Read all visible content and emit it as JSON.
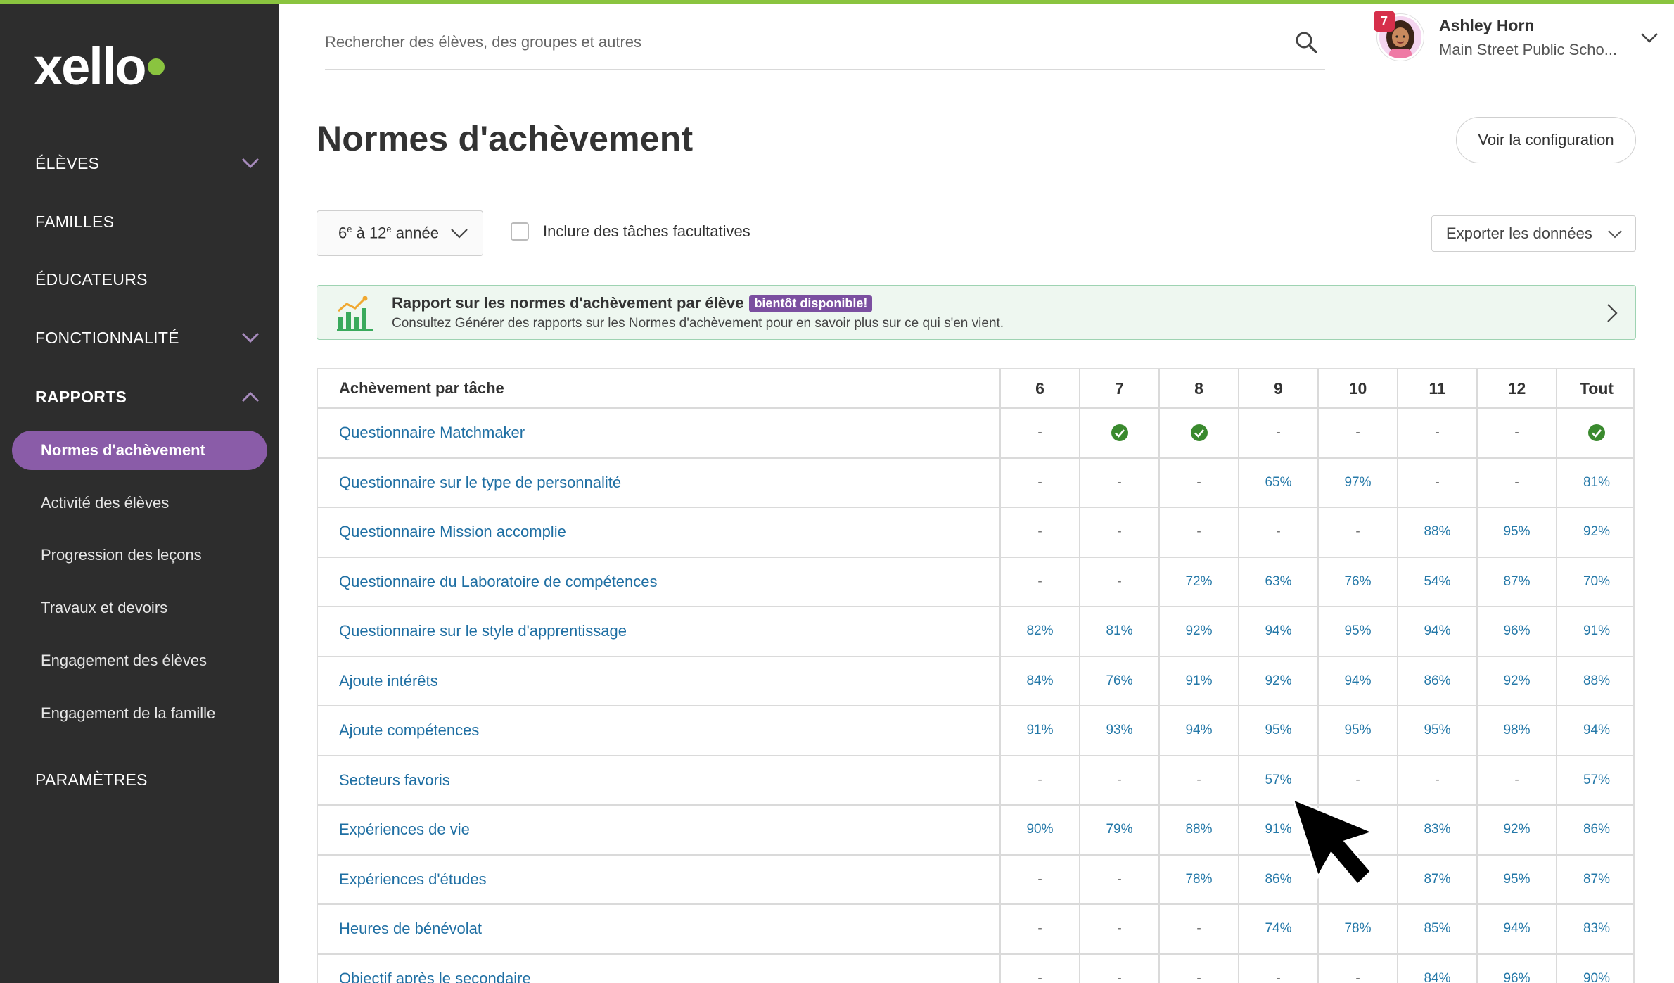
{
  "app": {
    "logo_text": "xello",
    "accent_color": "#8ac43f",
    "sidebar_bg": "#2d2d2d",
    "active_color": "#8a5ca8"
  },
  "sidebar": {
    "items": [
      {
        "label": "ÉLÈVES",
        "has_chevron": true,
        "expanded": false
      },
      {
        "label": "FAMILLES",
        "has_chevron": false
      },
      {
        "label": "ÉDUCATEURS",
        "has_chevron": false
      },
      {
        "label": "FONCTIONNALITÉ",
        "has_chevron": true,
        "expanded": false
      },
      {
        "label": "RAPPORTS",
        "has_chevron": true,
        "expanded": true
      },
      {
        "label": "PARAMÈTRES",
        "has_chevron": false
      }
    ],
    "reports_sub": [
      {
        "label": "Normes d'achèvement",
        "active": true
      },
      {
        "label": "Activité des élèves"
      },
      {
        "label": "Progression des leçons"
      },
      {
        "label": "Travaux et devoirs"
      },
      {
        "label": "Engagement des élèves"
      },
      {
        "label": "Engagement de la famille"
      }
    ]
  },
  "header": {
    "search_placeholder": "Rechercher des élèves, des groupes et autres",
    "search_icon": "search-icon",
    "user": {
      "name": "Ashley Horn",
      "school": "Main Street Public Scho...",
      "notifications": "7"
    }
  },
  "page": {
    "title": "Normes d'achèvement",
    "config_button": "Voir la configuration",
    "grade_select": {
      "prefix": "6",
      "sup1": "e",
      "mid": " à 12",
      "sup2": "e",
      "suffix": " année"
    },
    "optional_checkbox": {
      "label": "Inclure des tâches facultatives",
      "checked": false
    },
    "export_button": "Exporter les données"
  },
  "banner": {
    "title": "Rapport sur les normes d'achèvement par élève",
    "badge": "bientôt disponible!",
    "subtitle": "Consultez Générer des rapports sur les Normes d'achèvement pour en savoir plus sur ce qui s'en vient."
  },
  "table": {
    "task_header": "Achèvement par tâche",
    "columns": [
      "6",
      "7",
      "8",
      "9",
      "10",
      "11",
      "12",
      "Tout"
    ],
    "rows": [
      {
        "task": "Questionnaire Matchmaker",
        "values": [
          "-",
          "check",
          "check",
          "-",
          "-",
          "-",
          "-",
          "check"
        ]
      },
      {
        "task": "Questionnaire sur le type de personnalité",
        "values": [
          "-",
          "-",
          "-",
          "65%",
          "97%",
          "-",
          "-",
          "81%"
        ]
      },
      {
        "task": "Questionnaire Mission accomplie",
        "values": [
          "-",
          "-",
          "-",
          "-",
          "-",
          "88%",
          "95%",
          "92%"
        ]
      },
      {
        "task": "Questionnaire du Laboratoire de compétences",
        "values": [
          "-",
          "-",
          "72%",
          "63%",
          "76%",
          "54%",
          "87%",
          "70%"
        ]
      },
      {
        "task": "Questionnaire sur le style d'apprentissage",
        "values": [
          "82%",
          "81%",
          "92%",
          "94%",
          "95%",
          "94%",
          "96%",
          "91%"
        ]
      },
      {
        "task": "Ajoute intérêts",
        "values": [
          "84%",
          "76%",
          "91%",
          "92%",
          "94%",
          "86%",
          "92%",
          "88%"
        ]
      },
      {
        "task": "Ajoute compétences",
        "values": [
          "91%",
          "93%",
          "94%",
          "95%",
          "95%",
          "95%",
          "98%",
          "94%"
        ]
      },
      {
        "task": "Secteurs favoris",
        "values": [
          "-",
          "-",
          "-",
          "57%",
          "-",
          "-",
          "-",
          "57%"
        ]
      },
      {
        "task": "Expériences de vie",
        "values": [
          "90%",
          "79%",
          "88%",
          "91%",
          "",
          "83%",
          "92%",
          "86%"
        ]
      },
      {
        "task": "Expériences d'études",
        "values": [
          "-",
          "-",
          "78%",
          "86%",
          "",
          "87%",
          "95%",
          "87%"
        ]
      },
      {
        "task": "Heures de bénévolat",
        "values": [
          "-",
          "-",
          "-",
          "74%",
          "78%",
          "85%",
          "94%",
          "83%"
        ]
      },
      {
        "task": "Objectif après le secondaire",
        "values": [
          "-",
          "-",
          "-",
          "-",
          "-",
          "84%",
          "96%",
          "90%"
        ]
      }
    ]
  }
}
